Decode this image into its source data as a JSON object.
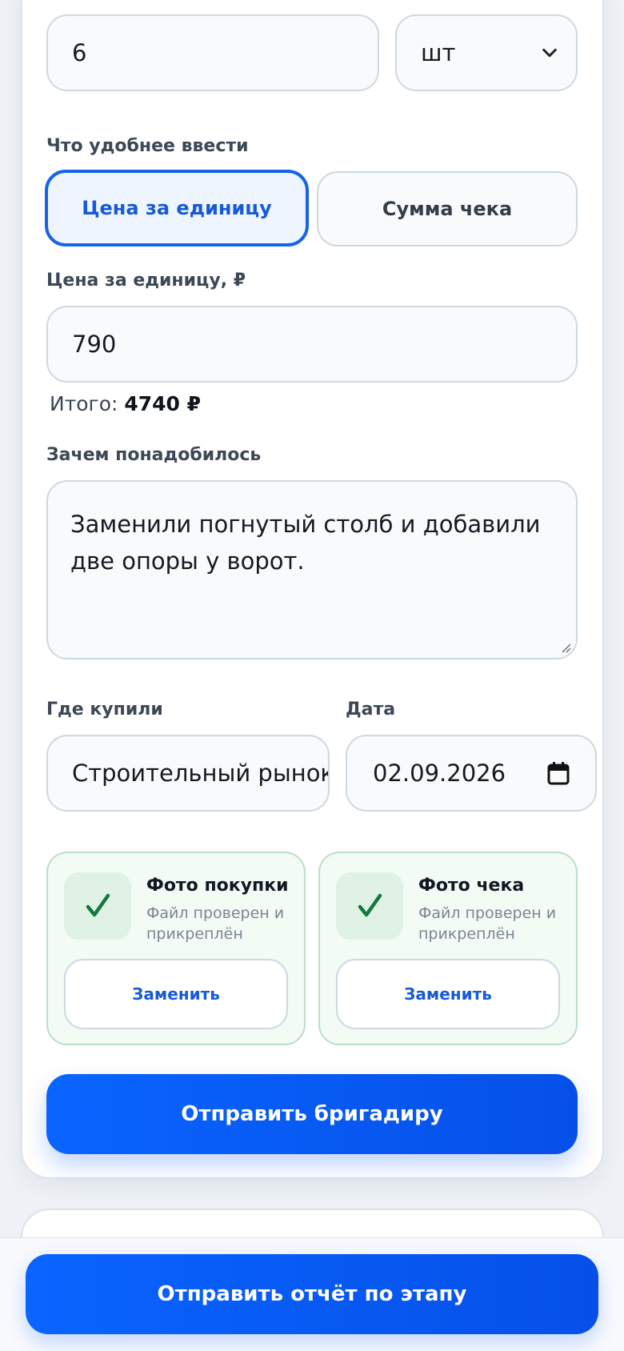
{
  "quantity": {
    "value": "6"
  },
  "unit": {
    "selected": "шт"
  },
  "input_mode": {
    "label": "Что удобнее ввести",
    "options": [
      "Цена за единицу",
      "Сумма чека"
    ],
    "selected": "Цена за единицу"
  },
  "price": {
    "label": "Цена за единицу, ₽",
    "value": "790"
  },
  "total": {
    "label": "Итого:",
    "value": "4740 ₽"
  },
  "reason": {
    "label": "Зачем понадобилось",
    "value": "Заменили погнутый столб и добавили две опоры у ворот."
  },
  "store": {
    "label": "Где купили",
    "value": "Строительный рынок"
  },
  "date": {
    "label": "Дата",
    "value": "02.09.2026"
  },
  "photos": [
    {
      "title": "Фото покупки",
      "status": "Файл проверен и прикреплён",
      "button": "Заменить"
    },
    {
      "title": "Фото чека",
      "status": "Файл проверен и прикреплён",
      "button": "Заменить"
    }
  ],
  "submit_button": "Отправить бригадиру",
  "bottom_button": "Отправить отчёт по этапу",
  "colors": {
    "accent": "#0a64ff",
    "success": "#1a8a45",
    "success_bg": "#f3fbf5"
  }
}
